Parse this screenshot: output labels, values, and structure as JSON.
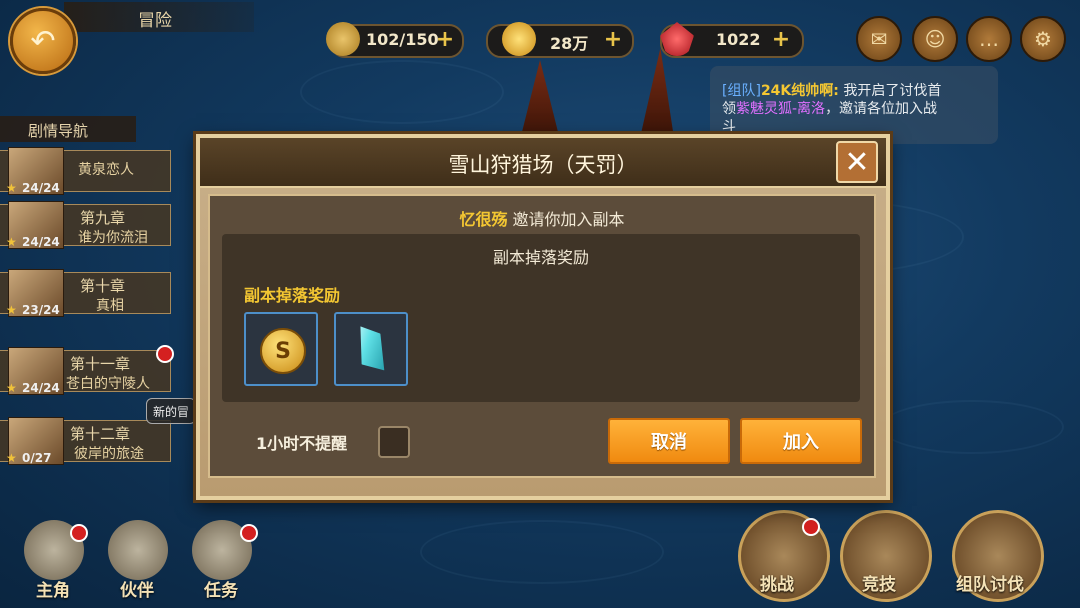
{
  "header": {
    "title": "冒险",
    "resources": [
      {
        "icon": "keys-icon",
        "value": "102/150"
      },
      {
        "icon": "coin-icon",
        "value": "28万"
      },
      {
        "icon": "ruby-icon",
        "value": "1022"
      }
    ]
  },
  "chat": {
    "line1_tag": "[组队]",
    "line1_name": "24K纯帅啊:",
    "line1_text": " 我开启了讨伐首",
    "line2_pre": "领",
    "line2_boss": "紫魅灵狐-离洛",
    "line2_text": "，邀请各位加入战",
    "line3_text": "斗"
  },
  "chapter_nav": {
    "title": "剧情导航",
    "items": [
      {
        "number": "",
        "name": "黄泉恋人",
        "progress": "24/24",
        "alert": false
      },
      {
        "number": "第九章",
        "name": "谁为你流泪",
        "progress": "24/24",
        "alert": false
      },
      {
        "number": "第十章",
        "name": "真相",
        "progress": "23/24",
        "alert": false
      },
      {
        "number": "第十一章",
        "name": "苍白的守陵人",
        "progress": "24/24",
        "alert": true
      },
      {
        "number": "第十二章",
        "name": "彼岸的旅途",
        "progress": "0/27",
        "alert": false
      }
    ],
    "new_tooltip": "新的冒"
  },
  "dialog": {
    "title": "雪山狩猎场（天罚）",
    "inviter": "忆很殇",
    "invite_text": "邀请你加入副本",
    "reward_header": "副本掉落奖励",
    "reward_sub": "副本掉落奖励",
    "rewards": [
      "gold-coin-icon",
      "crystal-icon"
    ],
    "remind_label": "1小时不提醒",
    "remind_checked": false,
    "cancel_label": "取消",
    "join_label": "加入"
  },
  "bottom_bar": {
    "left": [
      {
        "label": "主角",
        "alert": true
      },
      {
        "label": "伙伴",
        "alert": false
      },
      {
        "label": "任务",
        "alert": true
      }
    ],
    "right": [
      {
        "label": "挑战",
        "alert": true
      },
      {
        "label": "竞技",
        "alert": false
      },
      {
        "label": "组队讨伐",
        "alert": false
      }
    ]
  },
  "colors": {
    "accent": "#f4c732",
    "button": "#f59a1e",
    "ocean": "#123a60"
  }
}
